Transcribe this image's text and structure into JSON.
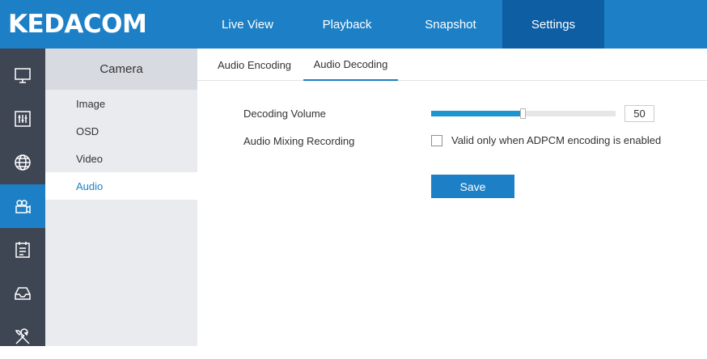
{
  "brand": {
    "logo": "KEDACOM",
    "primary_color": "#1d80c6",
    "active_nav_color": "#0d5ea3"
  },
  "nav": {
    "tabs": [
      {
        "label": "Live View"
      },
      {
        "label": "Playback"
      },
      {
        "label": "Snapshot"
      },
      {
        "label": "Settings",
        "active": true
      }
    ]
  },
  "iconbar": {
    "items": [
      {
        "icon": "monitor-icon"
      },
      {
        "icon": "equalizer-icon"
      },
      {
        "icon": "network-globe-icon"
      },
      {
        "icon": "camera-icon",
        "active": true
      },
      {
        "icon": "event-calendar-icon"
      },
      {
        "icon": "storage-tray-icon"
      },
      {
        "icon": "tools-icon"
      }
    ]
  },
  "sidebar": {
    "header": "Camera",
    "items": [
      {
        "label": "Image"
      },
      {
        "label": "OSD"
      },
      {
        "label": "Video"
      },
      {
        "label": "Audio",
        "active": true
      }
    ]
  },
  "subtabs": [
    {
      "label": "Audio Encoding"
    },
    {
      "label": "Audio Decoding",
      "active": true
    }
  ],
  "form": {
    "decoding_volume_label": "Decoding Volume",
    "volume_value": "50",
    "volume_min": 0,
    "volume_max": 100,
    "mixing_label": "Audio Mixing Recording",
    "mixing_checked": false,
    "mixing_hint": "Valid only when ADPCM encoding is enabled",
    "save_label": "Save"
  }
}
